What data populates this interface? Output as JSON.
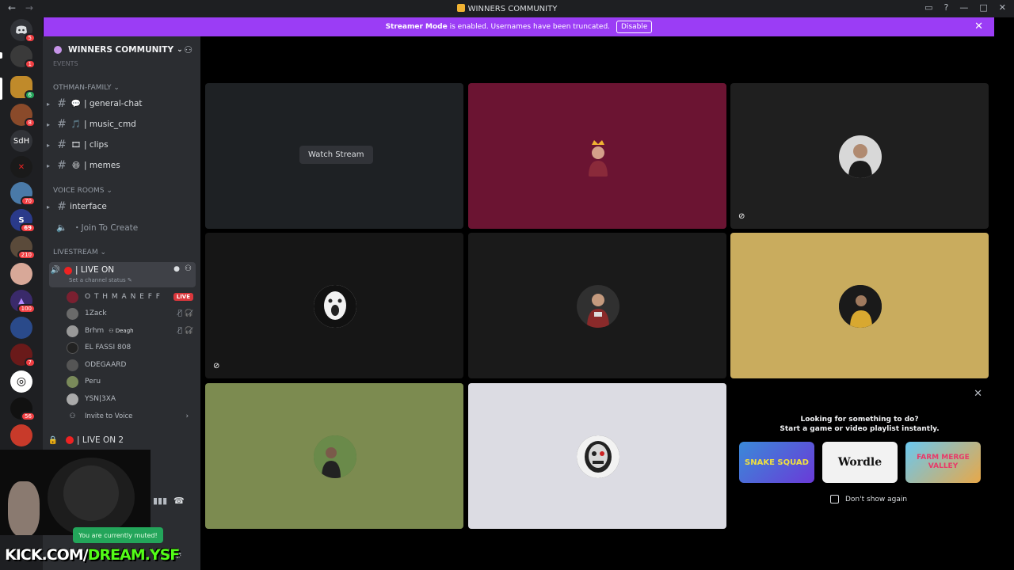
{
  "window": {
    "title": "WINNERS COMMUNITY"
  },
  "banner": {
    "text_bold": "Streamer Mode",
    "text": " is enabled. Usernames have been truncated.",
    "disable_label": "Disable"
  },
  "server_rail": {
    "sdh_label": "SdH",
    "badges": [
      "5",
      "1",
      "6",
      "8",
      "70",
      "69",
      "210",
      "100",
      "7",
      "56"
    ]
  },
  "sidebar": {
    "guild_name": "WINNERS COMMUNITY",
    "events_label": "EVENTS",
    "categories": {
      "family": "OTHMAN-FAMILY",
      "voice": "VOICE ROOMS",
      "livestream": "LIVESTREAM"
    },
    "text_channels": [
      {
        "emoji": "💬",
        "name": "| general-chat"
      },
      {
        "emoji": "🎵",
        "name": "| music_cmd"
      },
      {
        "emoji": "🎞",
        "name": "| clips"
      },
      {
        "emoji": "😆",
        "name": "| memes"
      }
    ],
    "interface_channel": "interface",
    "join_to_create": "・Join To Create",
    "live_channel": {
      "name": "| LIVE ON",
      "status": "Set a channel status"
    },
    "members": [
      {
        "name": "O T H M A N E F F",
        "live": "LIVE",
        "color": "#7a2030"
      },
      {
        "name": "1Zack",
        "color": "#6a6a6a"
      },
      {
        "name": "Brhm",
        "tag": "Deagh",
        "color": "#999"
      },
      {
        "name": "EL FASSI 808",
        "color": "#222"
      },
      {
        "name": "ODEGAARD",
        "color": "#555"
      },
      {
        "name": "Peru",
        "color": "#7a8a5a"
      },
      {
        "name": "YSN|3XA",
        "color": "#aaa"
      }
    ],
    "invite_label": "Invite to Voice",
    "live_channel_2": "| LIVE ON 2",
    "muted_toast": "You are currently muted!",
    "overlay_text_white": "KICK.COM/",
    "overlay_text_green": "DREAM.YSF"
  },
  "stage": {
    "watch_stream_label": "Watch Stream",
    "tiles": [
      {
        "bg": "#1e2124",
        "avatar": null
      },
      {
        "bg": "#6b1432",
        "avatar": "#8a2a3a"
      },
      {
        "bg": "#1f1f1f",
        "avatar": "#d8d8d8"
      },
      {
        "bg": "#161616",
        "avatar": "#e8e8e8"
      },
      {
        "bg": "#1a1a1a",
        "avatar": "#303030"
      },
      {
        "bg": "#c9ac5e",
        "avatar": "#2a2a2a"
      },
      {
        "bg": "#7c8b50",
        "avatar": "#4d6a3a"
      },
      {
        "bg": "#dcdce3",
        "avatar": "#2b2b2b"
      }
    ],
    "activity": {
      "line1": "Looking for something to do?",
      "line2": "Start a game or video playlist instantly.",
      "games": [
        "SNAKE SQUAD",
        "Wordle",
        "FARM MERGE VALLEY"
      ],
      "dont_show": "Don't show again"
    }
  }
}
